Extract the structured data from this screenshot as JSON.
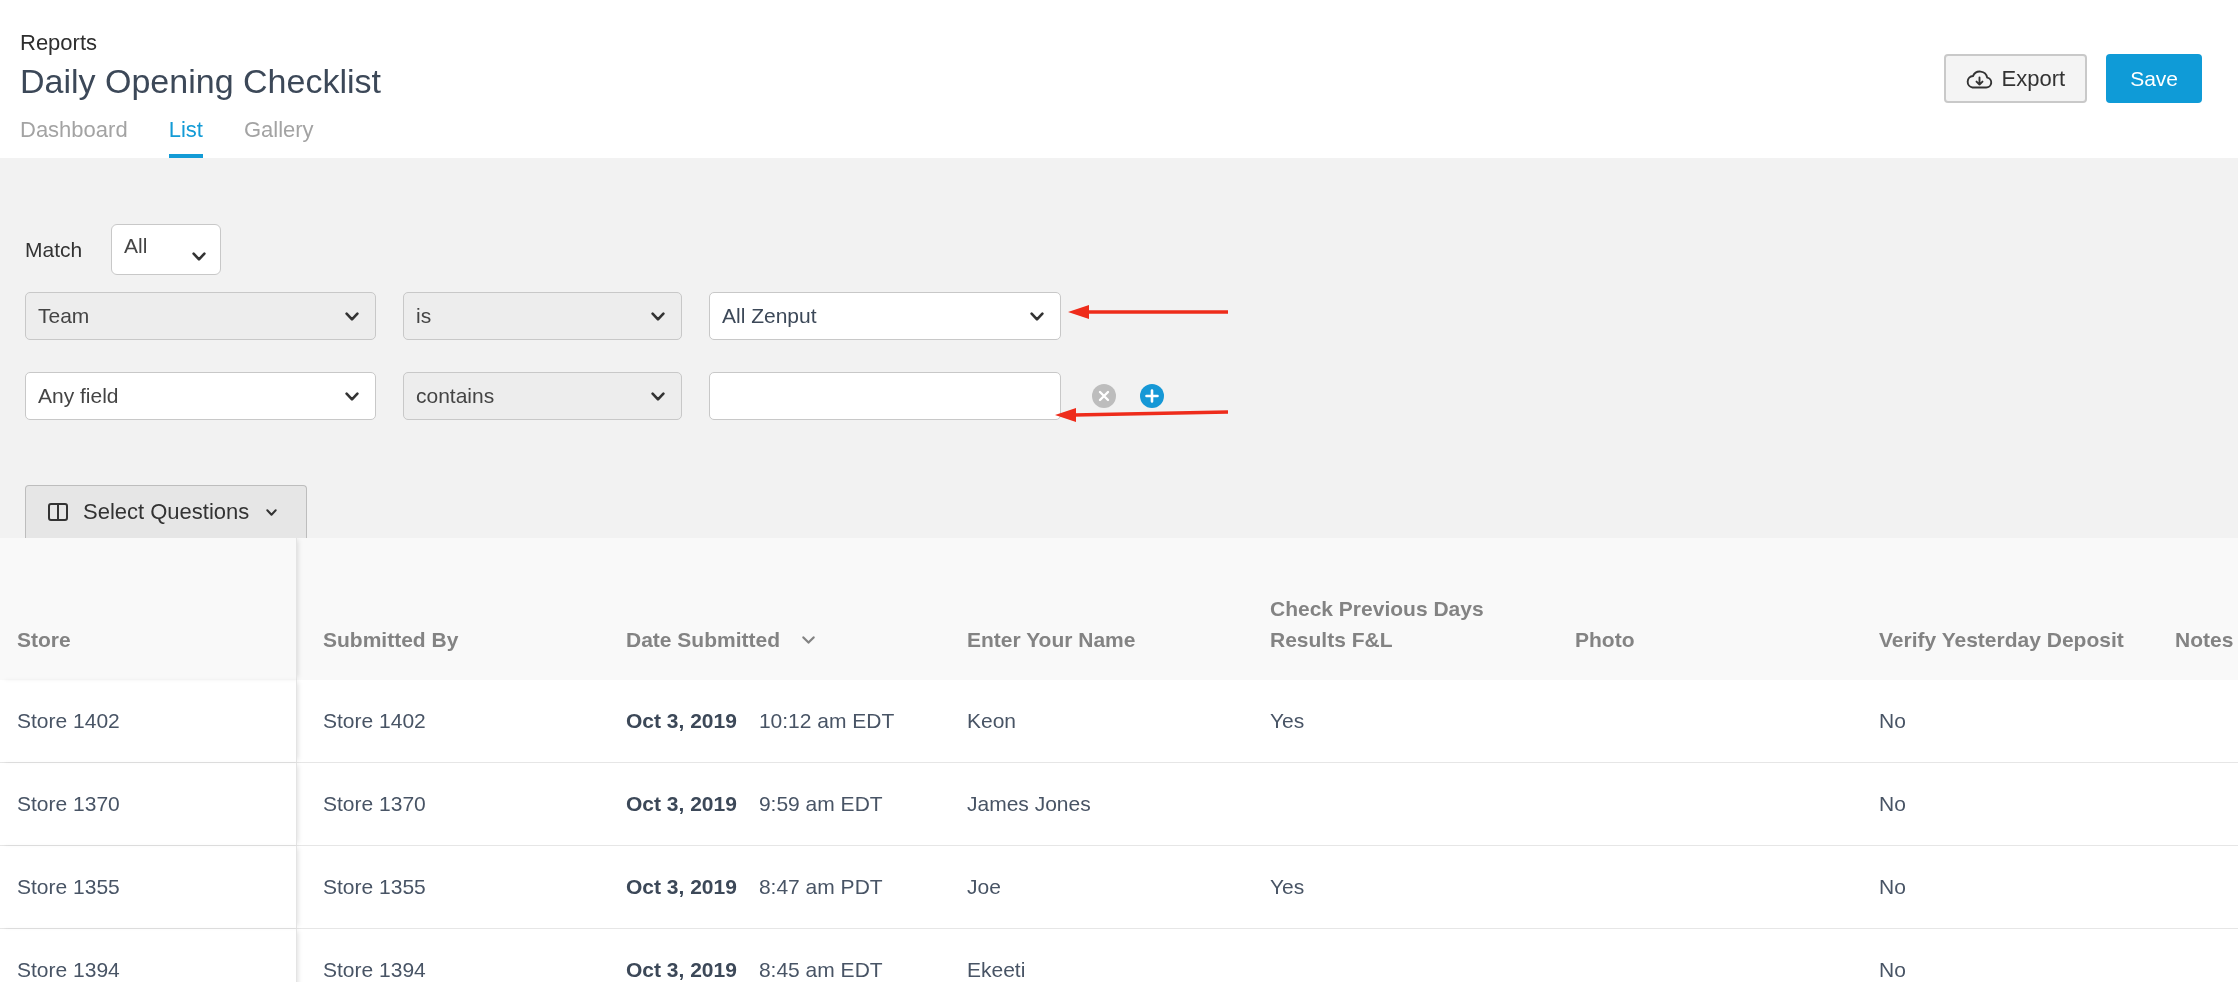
{
  "breadcrumb": "Reports",
  "title": "Daily Opening Checklist",
  "tabs": [
    {
      "label": "Dashboard",
      "selected": false
    },
    {
      "label": "List",
      "selected": true
    },
    {
      "label": "Gallery",
      "selected": false
    }
  ],
  "actions": [
    {
      "kind": "export",
      "label": "Export"
    },
    {
      "kind": "save",
      "label": "Save"
    }
  ],
  "filters": {
    "match_label": "Match",
    "match_value": "All",
    "rows": [
      {
        "field": {
          "value": "Team",
          "disabled": true
        },
        "operator": {
          "value": "is",
          "disabled": true
        },
        "value": {
          "kind": "select",
          "value": "All Zenput",
          "disabled": false
        },
        "pointer_arrow": true
      },
      {
        "field": {
          "value": "Any field",
          "disabled": false
        },
        "operator": {
          "value": "contains",
          "disabled": true
        },
        "value": {
          "kind": "text"
        },
        "buttons": [
          {
            "kind": "remove"
          },
          {
            "kind": "add"
          }
        ],
        "pointer_arrow": true
      }
    ]
  },
  "select_questions": {
    "label": "Select Questions"
  },
  "table": {
    "columns": [
      {
        "label": "Store",
        "sorted": false
      },
      {
        "label": "Submitted By",
        "sorted": false
      },
      {
        "label": "Date Submitted",
        "sorted": true
      },
      {
        "label": "Enter Your Name",
        "sorted": false
      },
      {
        "label": "Check Previous Days Results F&L",
        "sorted": false
      },
      {
        "label": "Photo",
        "sorted": false
      },
      {
        "label": "Verify Yesterday Deposit",
        "sorted": false
      },
      {
        "label": "Notes",
        "sorted": false
      }
    ],
    "rows": [
      {
        "cells": [
          "Store 1402",
          "Store 1402",
          {
            "date": "Oct 3, 2019",
            "time": "10:12 am EDT"
          },
          "Keon",
          "Yes",
          null,
          "No",
          null
        ]
      },
      {
        "cells": [
          "Store 1370",
          "Store 1370",
          {
            "date": "Oct 3, 2019",
            "time": "9:59 am EDT"
          },
          "James Jones",
          null,
          null,
          "No",
          null
        ]
      },
      {
        "cells": [
          "Store 1355",
          "Store 1355",
          {
            "date": "Oct 3, 2019",
            "time": "8:47 am PDT"
          },
          "Joe",
          "Yes",
          null,
          "No",
          null
        ]
      },
      {
        "cells": [
          "Store 1394",
          "Store 1394",
          {
            "date": "Oct 3, 2019",
            "time": "8:45 am EDT"
          },
          "Ekeeti",
          null,
          null,
          "No",
          null
        ]
      }
    ]
  }
}
